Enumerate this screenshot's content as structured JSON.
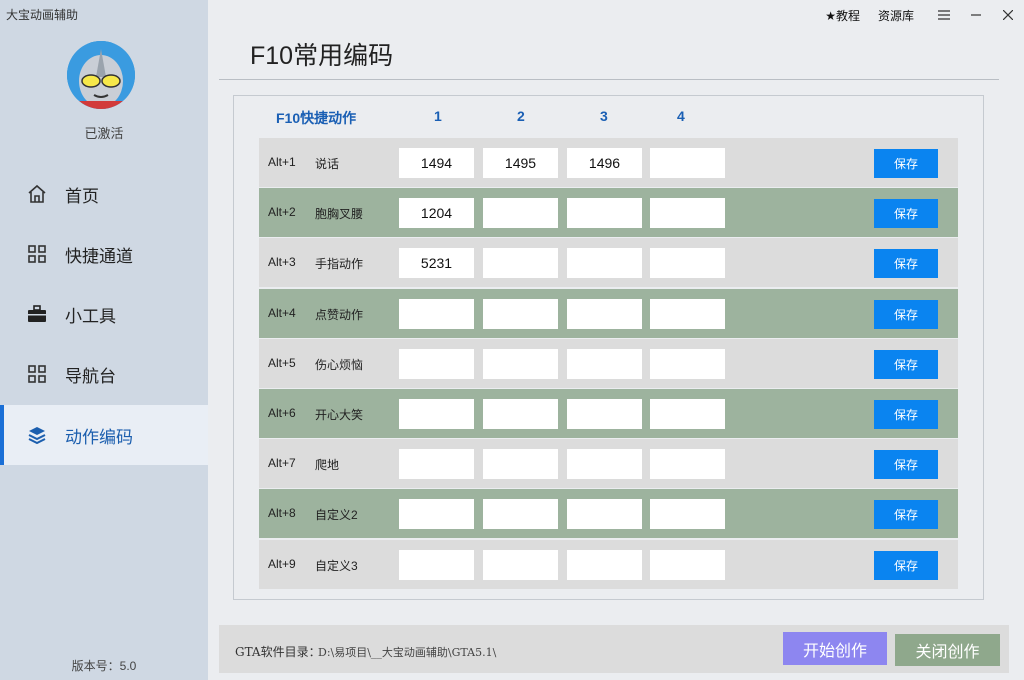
{
  "app": {
    "title": "大宝动画辅助",
    "activated": "已激活",
    "version": "版本号：5.0"
  },
  "topbar": {
    "tutorial": "★教程",
    "resources": "资源库"
  },
  "nav": [
    {
      "label": "首页",
      "icon": "home-icon"
    },
    {
      "label": "快捷通道",
      "icon": "grid-icon"
    },
    {
      "label": "小工具",
      "icon": "toolbox-icon"
    },
    {
      "label": "导航台",
      "icon": "grid-icon"
    },
    {
      "label": "动作编码",
      "icon": "layers-icon",
      "active": true
    }
  ],
  "page": {
    "title": "F10常用编码"
  },
  "table": {
    "headers": [
      "F10快捷动作",
      "1",
      "2",
      "3",
      "4"
    ],
    "save_label": "保存",
    "rows": [
      {
        "key": "Alt+1",
        "name": "说话",
        "codes": [
          "1494",
          "1495",
          "1496",
          ""
        ]
      },
      {
        "key": "Alt+2",
        "name": "胞胸叉腰",
        "codes": [
          "1204",
          "",
          "",
          ""
        ]
      },
      {
        "key": "Alt+3",
        "name": "手指动作",
        "codes": [
          "5231",
          "",
          "",
          ""
        ]
      },
      {
        "key": "Alt+4",
        "name": "点赞动作",
        "codes": [
          "",
          "",
          "",
          ""
        ]
      },
      {
        "key": "Alt+5",
        "name": "伤心烦恼",
        "codes": [
          "",
          "",
          "",
          ""
        ]
      },
      {
        "key": "Alt+6",
        "name": "开心大笑",
        "codes": [
          "",
          "",
          "",
          ""
        ]
      },
      {
        "key": "Alt+7",
        "name": "爬地",
        "codes": [
          "",
          "",
          "",
          ""
        ]
      },
      {
        "key": "Alt+8",
        "name": "自定义2",
        "codes": [
          "",
          "",
          "",
          ""
        ]
      },
      {
        "key": "Alt+9",
        "name": "自定义3",
        "codes": [
          "",
          "",
          "",
          ""
        ]
      }
    ]
  },
  "footer": {
    "dir_label": "GTA软件目录：",
    "dir_path": "D:\\易项目\\__大宝动画辅助\\GTA5.1\\",
    "start_label": "开始创作",
    "close_label": "关闭创作"
  },
  "colors": {
    "accent": "#0a84f0",
    "row_green": "#9db39e",
    "row_light": "#dcdcdc",
    "start_btn": "#8d86f0",
    "close_btn": "#8fa88c"
  }
}
